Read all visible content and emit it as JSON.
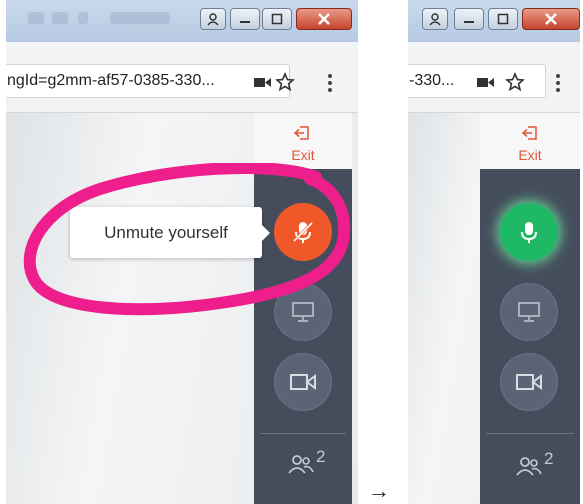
{
  "left_screen": {
    "address": {
      "url": "ngId=g2mm-af57-0385-330..."
    },
    "sidebar": {
      "exit_label": "Exit",
      "participant_count": "2"
    },
    "tooltip": {
      "text": "Unmute yourself"
    },
    "mic_state": "muted"
  },
  "right_screen": {
    "address": {
      "url": "-330..."
    },
    "sidebar": {
      "exit_label": "Exit",
      "participant_count": "2"
    },
    "mic_state": "unmuted"
  },
  "transition_arrow": "→",
  "colors": {
    "mute_orange": "#f0582a",
    "unmute_green": "#1fb865",
    "sidebar": "#454d5c",
    "annotation_magenta": "#ee1e8c",
    "exit_red": "#e0573a"
  },
  "icons": [
    "user-icon",
    "minimize-icon",
    "maximize-icon",
    "close-icon",
    "camera-icon",
    "star-icon",
    "kebab-menu-icon",
    "exit-icon",
    "microphone-muted-icon",
    "microphone-icon",
    "screen-share-icon",
    "video-camera-icon",
    "participants-icon"
  ]
}
